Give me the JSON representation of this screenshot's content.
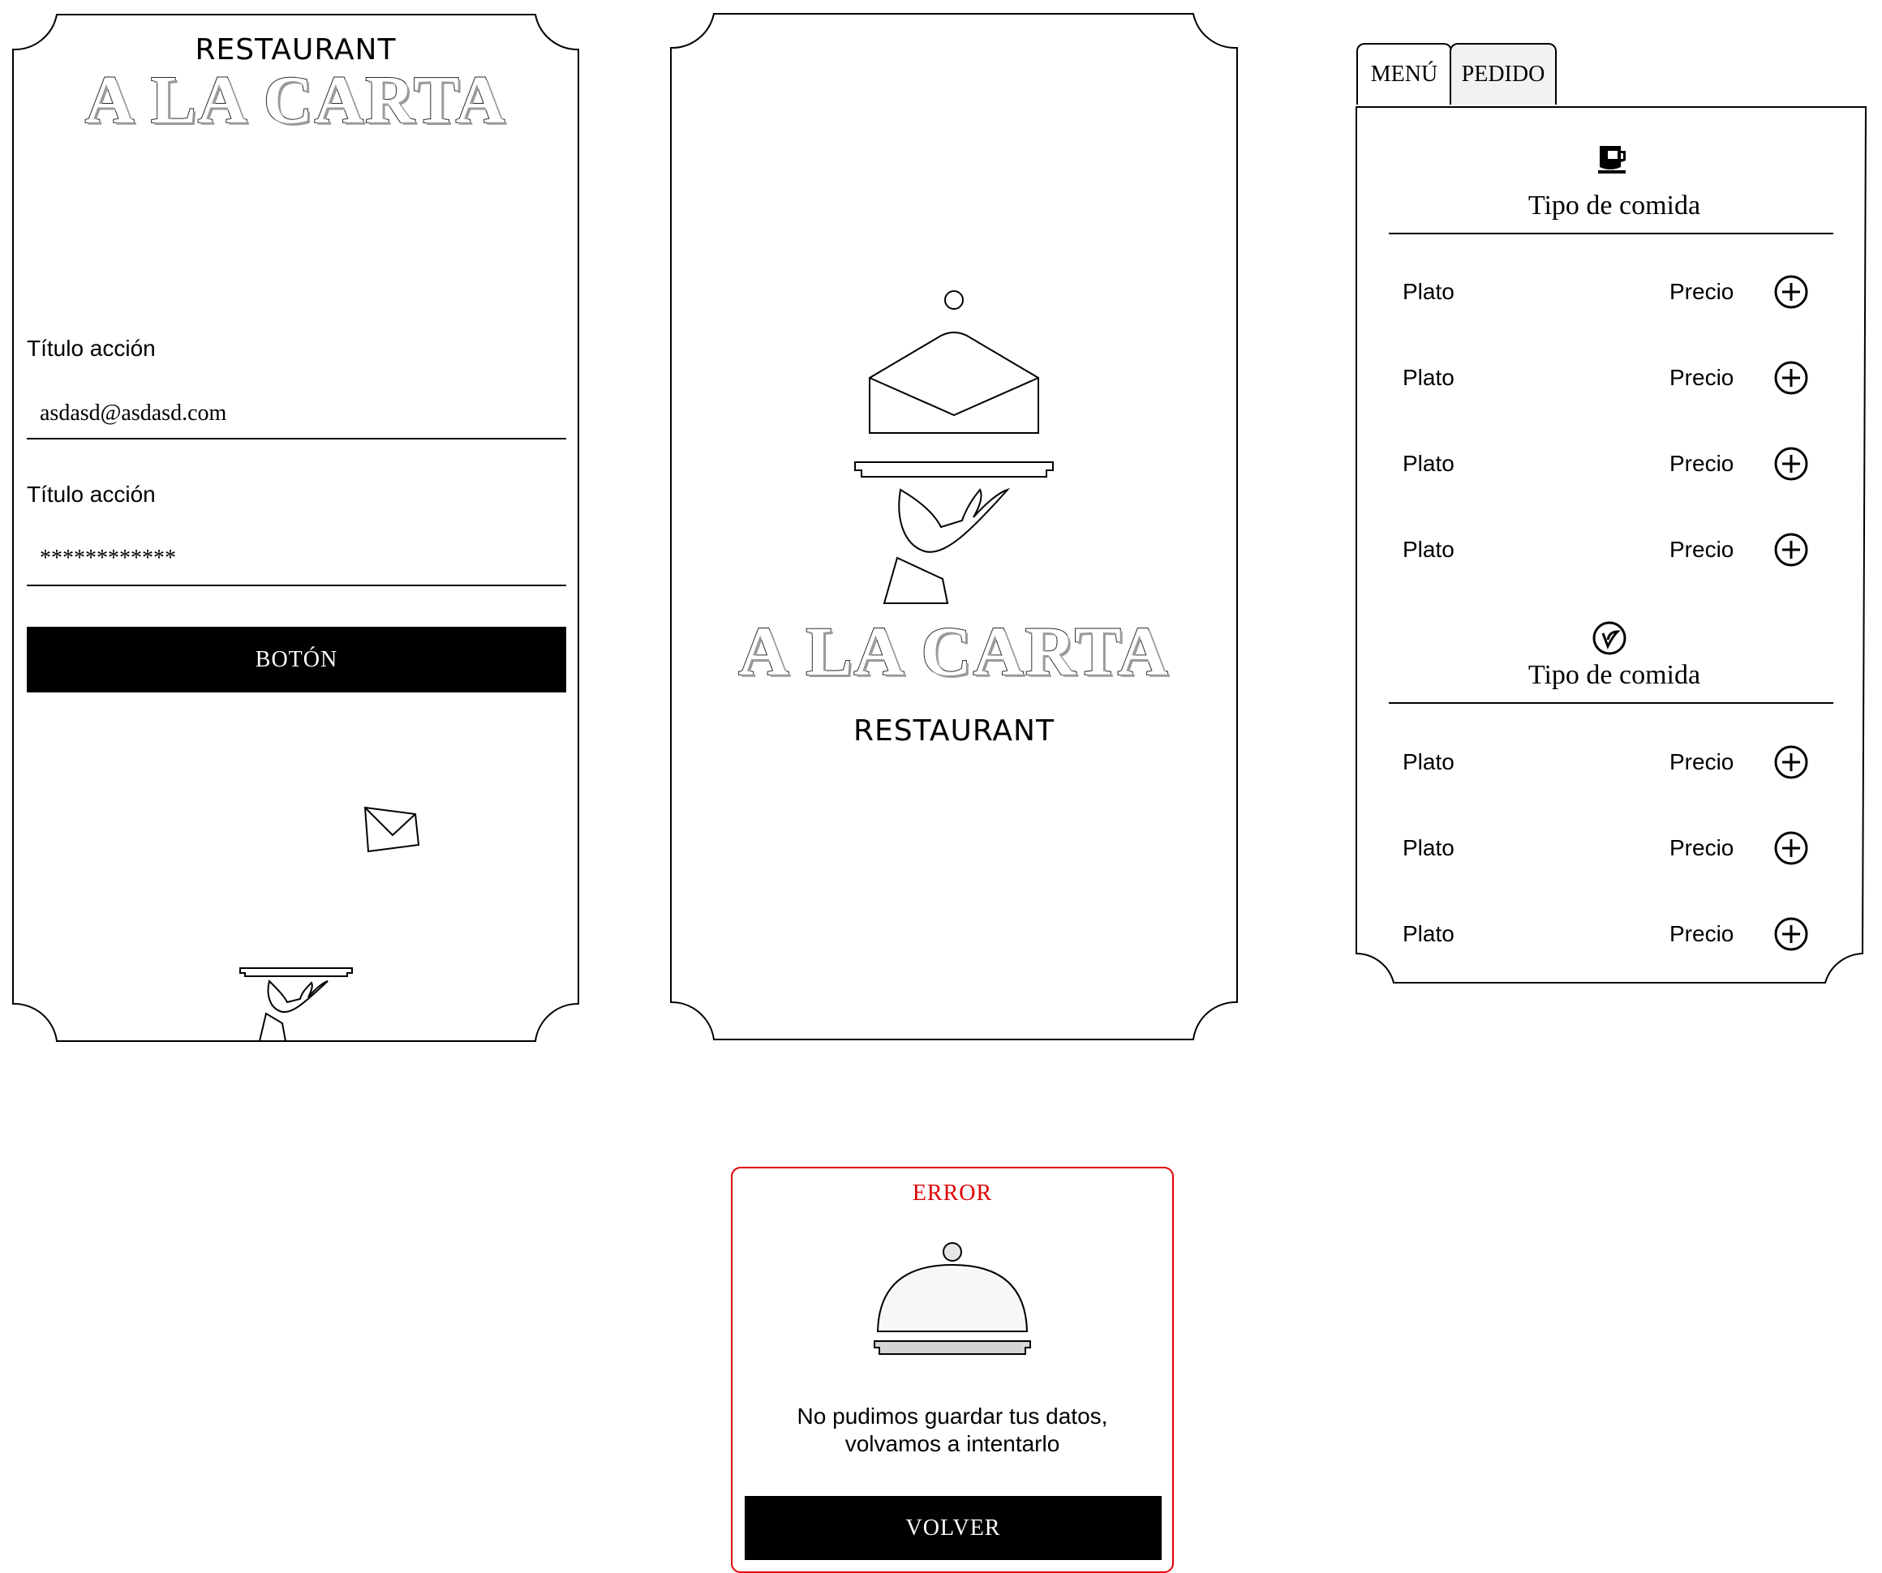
{
  "login": {
    "restaurant_label": "RESTAURANT",
    "logo_text": "A LA CARTA",
    "field1_label": "Título acción",
    "field1_value": "asdasd@asdasd.com",
    "field2_label": "Título acción",
    "field2_value": "************",
    "button_label": "BOTÓN"
  },
  "splash": {
    "logo_text": "A LA CARTA",
    "restaurant_label": "RESTAURANT"
  },
  "menu": {
    "tabs": [
      {
        "label": "MENÚ"
      },
      {
        "label": "PEDIDO"
      }
    ],
    "categories": [
      {
        "title": "Tipo de comida",
        "icon": "coffee-cup-icon",
        "items": [
          {
            "plato": "Plato",
            "precio": "Precio"
          },
          {
            "plato": "Plato",
            "precio": "Precio"
          },
          {
            "plato": "Plato",
            "precio": "Precio"
          },
          {
            "plato": "Plato",
            "precio": "Precio"
          }
        ]
      },
      {
        "title": "Tipo de comida",
        "icon": "vegan-leaf-icon",
        "items": [
          {
            "plato": "Plato",
            "precio": "Precio"
          },
          {
            "plato": "Plato",
            "precio": "Precio"
          },
          {
            "plato": "Plato",
            "precio": "Precio"
          }
        ]
      }
    ]
  },
  "error": {
    "title": "ERROR",
    "message_line1": "No pudimos guardar tus datos,",
    "message_line2": "volvamos a intentarlo",
    "button_label": "VOLVER",
    "accent_color": "#e00000"
  }
}
